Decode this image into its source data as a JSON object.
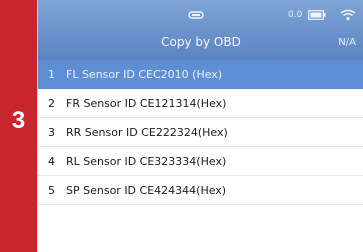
{
  "step_number": "3",
  "status_bar": {
    "vci_label": "0.0",
    "icons": [
      "bluetooth-icon",
      "battery-icon",
      "wifi-icon"
    ]
  },
  "header": {
    "title": "Copy by OBD",
    "right_label": "N/A"
  },
  "sensor_list": [
    {
      "index": "1",
      "text": "FL Sensor ID CEC2010 (Hex)",
      "selected": true
    },
    {
      "index": "2",
      "text": "FR Sensor ID CE121314(Hex)",
      "selected": false
    },
    {
      "index": "3",
      "text": "RR Sensor ID CE222324(Hex)",
      "selected": false
    },
    {
      "index": "4",
      "text": "RL Sensor ID CE323334(Hex)",
      "selected": false
    },
    {
      "index": "5",
      "text": "SP Sensor ID CE424344(Hex)",
      "selected": false
    }
  ],
  "colors": {
    "badge": "#c8262e",
    "header": "#6b92cc",
    "selected_row": "#5e8ed4"
  }
}
